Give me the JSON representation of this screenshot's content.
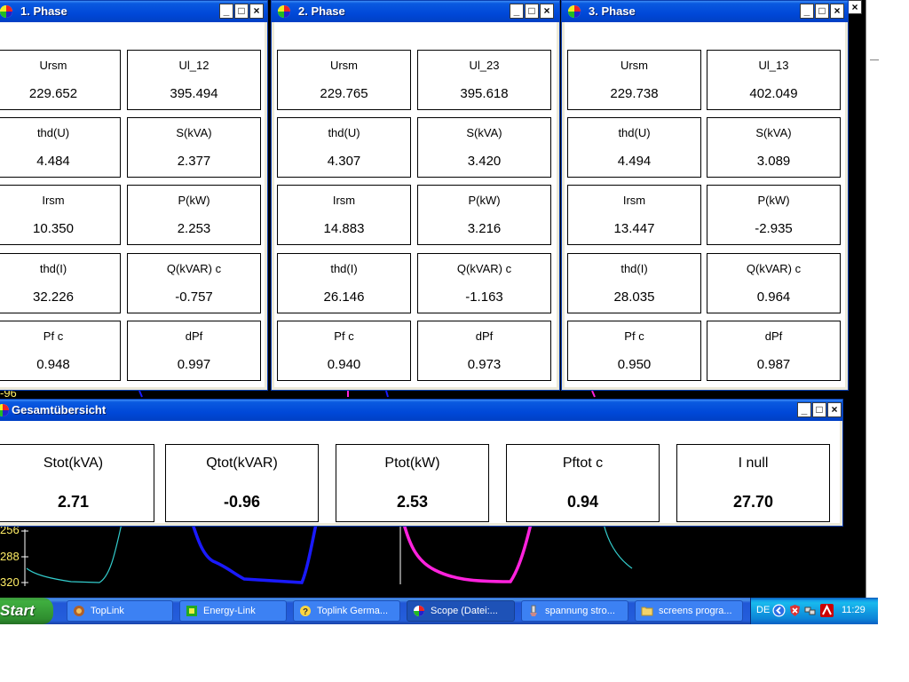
{
  "scope": {
    "y_labels": [
      "-96",
      "256",
      "288",
      "320"
    ],
    "colors": {
      "background": "#000000",
      "cyan": "#33cccc",
      "blue": "#1a1aff",
      "magenta": "#ff22dd",
      "label": "#ffee66"
    }
  },
  "phase_windows": [
    {
      "title": "1. Phase",
      "cells": [
        {
          "label": "Ursm",
          "value": "229.652"
        },
        {
          "label": "Ul_12",
          "value": "395.494"
        },
        {
          "label": "thd(U)",
          "value": "4.484"
        },
        {
          "label": "S(kVA)",
          "value": "2.377"
        },
        {
          "label": "Irsm",
          "value": "10.350"
        },
        {
          "label": "P(kW)",
          "value": "2.253"
        },
        {
          "label": "thd(I)",
          "value": "32.226"
        },
        {
          "label": "Q(kVAR) c",
          "value": "-0.757"
        },
        {
          "label": "Pf  c",
          "value": "0.948"
        },
        {
          "label": "dPf",
          "value": "0.997"
        }
      ]
    },
    {
      "title": "2. Phase",
      "cells": [
        {
          "label": "Ursm",
          "value": "229.765"
        },
        {
          "label": "Ul_23",
          "value": "395.618"
        },
        {
          "label": "thd(U)",
          "value": "4.307"
        },
        {
          "label": "S(kVA)",
          "value": "3.420"
        },
        {
          "label": "Irsm",
          "value": "14.883"
        },
        {
          "label": "P(kW)",
          "value": "3.216"
        },
        {
          "label": "thd(I)",
          "value": "26.146"
        },
        {
          "label": "Q(kVAR) c",
          "value": "-1.163"
        },
        {
          "label": "Pf  c",
          "value": "0.940"
        },
        {
          "label": "dPf",
          "value": "0.973"
        }
      ]
    },
    {
      "title": "3. Phase",
      "cells": [
        {
          "label": "Ursm",
          "value": "229.738"
        },
        {
          "label": "Ul_13",
          "value": "402.049"
        },
        {
          "label": "thd(U)",
          "value": "4.494"
        },
        {
          "label": "S(kVA)",
          "value": "3.089"
        },
        {
          "label": "Irsm",
          "value": "13.447"
        },
        {
          "label": "P(kW)",
          "value": "-2.935"
        },
        {
          "label": "thd(I)",
          "value": "28.035"
        },
        {
          "label": "Q(kVAR) c",
          "value": "0.964"
        },
        {
          "label": "Pf  c",
          "value": "0.950"
        },
        {
          "label": "dPf",
          "value": "0.987"
        }
      ]
    }
  ],
  "overview_window": {
    "title": "Gesamtübersicht",
    "cells": [
      {
        "label": "Stot(kVA)",
        "value": "2.71"
      },
      {
        "label": "Qtot(kVAR)",
        "value": "-0.96"
      },
      {
        "label": "Ptot(kW)",
        "value": "2.53"
      },
      {
        "label": "Pftot c",
        "value": "0.94"
      },
      {
        "label": "I null",
        "value": "27.70"
      }
    ]
  },
  "window_buttons": {
    "minimize": "_",
    "maximize": "□",
    "close": "×"
  },
  "taskbar": {
    "start_label": "Start",
    "tasks": [
      {
        "label": "TopLink",
        "icon": "toplink-icon"
      },
      {
        "label": "Energy-Link",
        "icon": "energy-link-icon"
      },
      {
        "label": "Toplink Germa...",
        "icon": "help-icon"
      },
      {
        "label": "Scope  (Datei:...",
        "icon": "scope-icon",
        "active": true
      },
      {
        "label": "spannung stro...",
        "icon": "paint-icon"
      },
      {
        "label": "screens progra...",
        "icon": "folder-icon"
      }
    ],
    "language": "DE",
    "clock": "11:29"
  }
}
